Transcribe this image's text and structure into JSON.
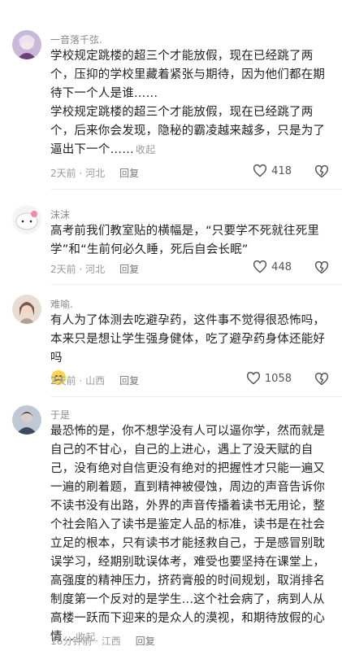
{
  "comments": [
    {
      "name": "一音落千弦.",
      "paragraphs": [
        "学校规定跳楼的超三个才能放假，现在已经跳了两个，压抑的学校里藏着紧张与期待，因为他们都在期待下一个人是谁……",
        "学校规定跳楼的超三个才能放假，现在已经跳了两个，后来你会发现，隐秘的霸凌越来越多，只是为了逼出下一个……"
      ],
      "collapse": "收起",
      "time": "2天前",
      "region": "河北",
      "reply": "回复",
      "likes": "418"
    },
    {
      "name": "沫沫",
      "paragraphs": [
        "高考前我们教室贴的横幅是，“只要学不死就往死里学”和“生前何必久睡，死后自会长眠”"
      ],
      "time": "2天前",
      "region": "河北",
      "reply": "回复",
      "likes": "448"
    },
    {
      "name": "难喻.",
      "paragraphs": [
        "有人为了体测去吃避孕药，这件事不觉得很恐怖吗，本来只是想让学生强身健体，吃了避孕药身体还能好吗"
      ],
      "time": "2天前",
      "region": "山西",
      "reply": "回复",
      "likes": "1058"
    },
    {
      "name": "于是",
      "paragraphs": [
        "最恐怖的是，你不想学没有人可以逼你学，然而就是自己的不甘心，自己的上进心，遇上了没天赋的自己，没有绝对自信更没有绝对的把握性才只能一遍又一遍的刷着题，直到精神被侵蚀，周边的声音告诉你不读书没有出路，外界的声音传播着读书无用论，整个社会陷入了读书是鉴定人品的标准，读书是在社会立足的根本，只有读书才能拯救自己，于是感冒别耽误学习，经期别耽误体考，难受也要坚持在课堂上，高强度的精神压力，挤药膏般的时间规划，取消排名制度第一个反对的是学生...这个社会病了，病到人从高楼一跃而下迎来的是众人的漠视，和期待放假的心情..."
      ],
      "collapse": "收起",
      "time": "16分钟前",
      "region": "江西",
      "reply": "回复"
    }
  ],
  "colors": {
    "text": "#222222",
    "meta": "#9a9a9a",
    "like_icon": "#555555"
  }
}
